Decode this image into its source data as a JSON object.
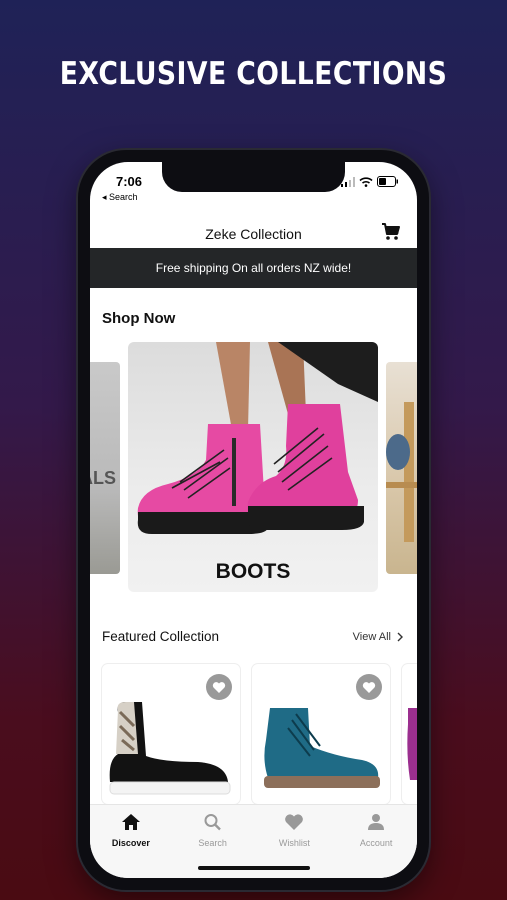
{
  "headline": "EXCLUSIVE COLLECTIONS",
  "status": {
    "time": "7:06",
    "back_label": "◂ Search"
  },
  "header": {
    "title": "Zeke Collection",
    "cart_icon": "cart-icon"
  },
  "banner": {
    "text": "Free shipping On all orders NZ wide!"
  },
  "shop_now": {
    "title": "Shop Now",
    "cards": [
      {
        "label": "ALS"
      },
      {
        "label": "BOOTS"
      },
      {
        "label": ""
      }
    ]
  },
  "featured": {
    "title": "Featured Collection",
    "view_all": "View All",
    "products": [
      {
        "image": "black-chelsea-boot",
        "wishlist_icon": "heart-icon"
      },
      {
        "image": "teal-lace-up-boot",
        "wishlist_icon": "heart-icon"
      }
    ]
  },
  "tabs": [
    {
      "label": "Discover",
      "icon": "home-icon",
      "active": true
    },
    {
      "label": "Search",
      "icon": "search-icon",
      "active": false
    },
    {
      "label": "Wishlist",
      "icon": "heart-icon",
      "active": false
    },
    {
      "label": "Account",
      "icon": "user-icon",
      "active": false
    }
  ],
  "colors": {
    "banner_bg": "#242628",
    "accent_pink": "#e64aa3",
    "teal": "#1f6b86"
  }
}
